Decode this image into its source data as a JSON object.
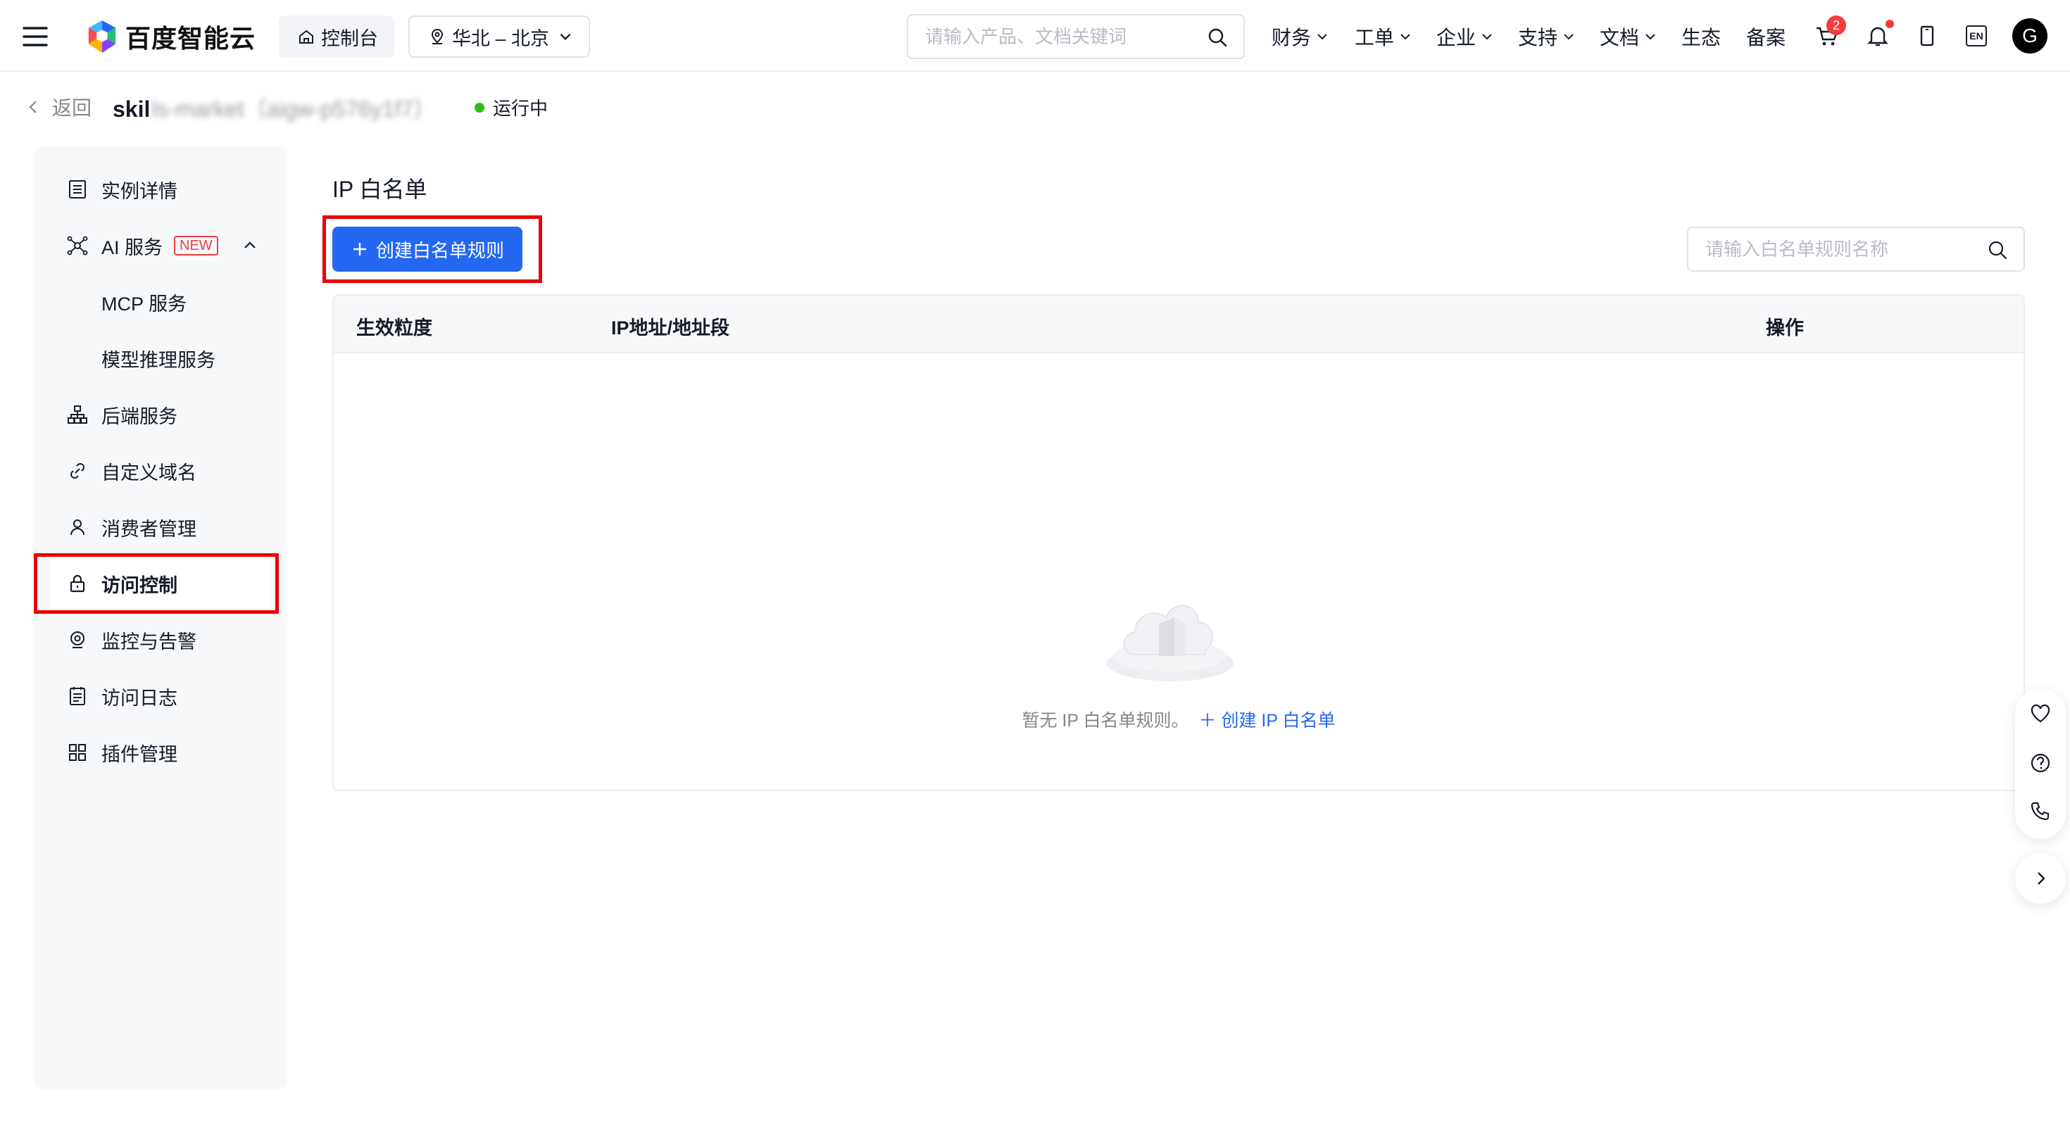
{
  "topbar": {
    "logo_text": "百度智能云",
    "console_label": "控制台",
    "region_label": "华北 – 北京",
    "search_placeholder": "请输入产品、文档关键词",
    "nav": [
      "财务",
      "工单",
      "企业",
      "支持",
      "文档",
      "生态",
      "备案"
    ],
    "cart_count": "2",
    "lang_label": "EN",
    "avatar_letter": "G"
  },
  "subheader": {
    "back_label": "返回",
    "instance_name_visible": "skil",
    "instance_name_blurred": "ls-market（aigw-p576y1f7）",
    "status_label": "运行中"
  },
  "sidebar": {
    "items": [
      {
        "label": "实例详情",
        "icon": "document-list-icon"
      },
      {
        "label": "AI 服务",
        "icon": "ai-network-icon",
        "badge": "NEW"
      },
      {
        "label": "MCP 服务"
      },
      {
        "label": "模型推理服务"
      },
      {
        "label": "后端服务",
        "icon": "hierarchy-icon"
      },
      {
        "label": "自定义域名",
        "icon": "link-icon"
      },
      {
        "label": "消费者管理",
        "icon": "user-icon"
      },
      {
        "label": "访问控制",
        "icon": "lock-icon",
        "active": true
      },
      {
        "label": "监控与告警",
        "icon": "monitor-icon"
      },
      {
        "label": "访问日志",
        "icon": "log-icon"
      },
      {
        "label": "插件管理",
        "icon": "grid-icon"
      }
    ]
  },
  "main": {
    "section_title": "IP 白名单",
    "create_button_label": "创建白名单规则",
    "rule_search_placeholder": "请输入白名单规则名称",
    "table": {
      "columns": [
        "生效粒度",
        "IP地址/地址段",
        "操作"
      ],
      "rows": [],
      "empty_text": "暂无 IP 白名单规则。",
      "empty_link": "创建 IP 白名单"
    }
  },
  "colors": {
    "primary": "#2468f2",
    "highlight": "#ea0000",
    "status_running": "#30bf13",
    "badge_red": "#f33e3e"
  }
}
